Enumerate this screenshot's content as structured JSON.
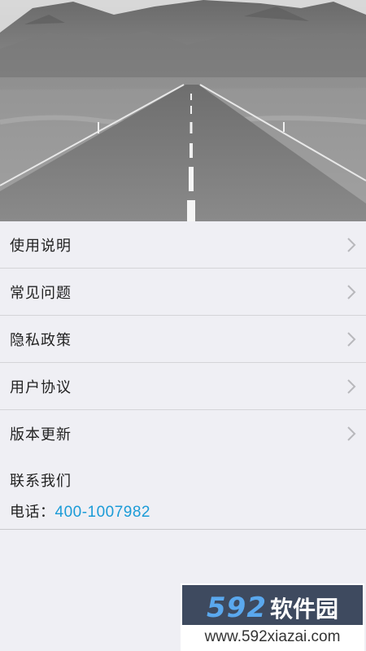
{
  "hero": {
    "image_name": "road-mountain-photo"
  },
  "menu": {
    "items": [
      {
        "label": "使用说明"
      },
      {
        "label": "常见问题"
      },
      {
        "label": "隐私政策"
      },
      {
        "label": "用户协议"
      },
      {
        "label": "版本更新"
      }
    ]
  },
  "contact": {
    "title": "联系我们",
    "phone_prefix": "电话：",
    "phone_number": "400-1007982"
  },
  "watermark": {
    "number": "592",
    "brand": "软件园",
    "url": "www.592xiazai.com"
  },
  "colors": {
    "background": "#efeff4",
    "link": "#1a9bd7",
    "divider": "#d4d4d8"
  }
}
